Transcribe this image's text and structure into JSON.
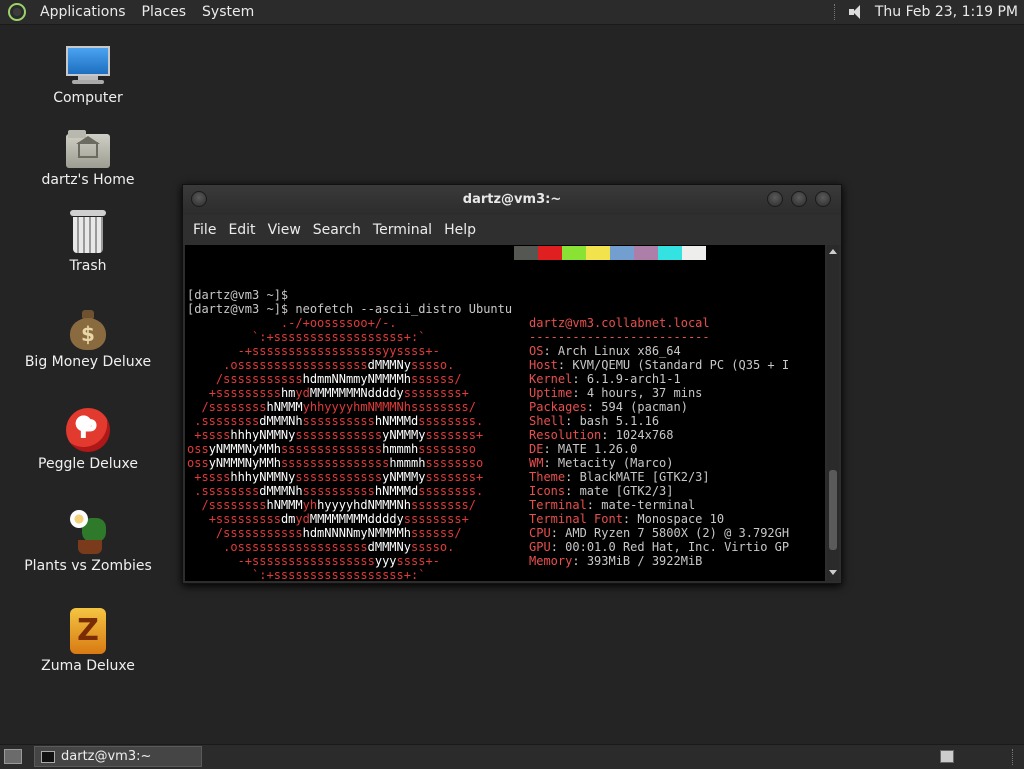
{
  "top_panel": {
    "menus": [
      "Applications",
      "Places",
      "System"
    ],
    "clock": "Thu Feb 23,  1:19 PM",
    "icons": {
      "logo": "mate-logo-icon",
      "volume": "volume-icon"
    }
  },
  "desktop": {
    "icons": [
      {
        "label": "Computer",
        "icon": "computer-icon"
      },
      {
        "label": "dartz's Home",
        "icon": "home-folder-icon"
      },
      {
        "label": "Trash",
        "icon": "trash-icon"
      },
      {
        "label": "Big Money Deluxe",
        "icon": "money-bag-icon"
      },
      {
        "label": "Peggle Deluxe",
        "icon": "peggle-icon"
      },
      {
        "label": "Plants vs Zombies",
        "icon": "plants-vs-zombies-icon"
      },
      {
        "label": "Zuma Deluxe",
        "icon": "zuma-icon"
      }
    ]
  },
  "terminal": {
    "title": "dartz@vm3:~",
    "menu": [
      "File",
      "Edit",
      "View",
      "Search",
      "Terminal",
      "Help"
    ],
    "palette": [
      "#555753",
      "#e02020",
      "#8ae234",
      "#f2e34c",
      "#729fcf",
      "#ad7fa8",
      "#34e2e2",
      "#eeeeec"
    ],
    "prompt_lines": [
      "[dartz@vm3 ~]$",
      "[dartz@vm3 ~]$ neofetch --ascii_distro Ubuntu"
    ],
    "ascii_art": [
      [
        "             ",
        ".-/+oossssoo+/-.",
        ""
      ],
      [
        "         ",
        "`:+ssssssssssssssssss+:`",
        ""
      ],
      [
        "       ",
        "-+ssssssssssssssssssyyssss+-",
        ""
      ],
      [
        "     ",
        ".ossssssssssssssssss",
        "dMMMNy",
        "sssso."
      ],
      [
        "    ",
        "/sssssssssss",
        "hdmmNNmmyNMMMMh",
        "ssssss/"
      ],
      [
        "   ",
        "+sssssssss",
        "hm",
        "yd",
        "MMMMMMMNddddy",
        "ssssssss+"
      ],
      [
        "  ",
        "/ssssssss",
        "hNMMM",
        "yh",
        "hyyyyhmNMMMNh",
        "ssssssss/"
      ],
      [
        " ",
        ".ssssssss",
        "dMMMNh",
        "ssssssssss",
        "hNMMMd",
        "ssssssss."
      ],
      [
        " ",
        "+ssss",
        "hhhyNMMNy",
        "ssssssssssss",
        "yNMMMy",
        "sssssss+"
      ],
      [
        "",
        "oss",
        "yNMMMNyMMh",
        "ssssssssssssss",
        "hmmmh",
        "ssssssso"
      ],
      [
        "",
        "oss",
        "yNMMMNyMMh",
        "sssssssssssssss",
        "hmmmh",
        "ssssssso"
      ],
      [
        " ",
        "+ssss",
        "hhhyNMMNy",
        "ssssssssssss",
        "yNMMMy",
        "sssssss+"
      ],
      [
        " ",
        ".ssssssss",
        "dMMMNh",
        "ssssssssss",
        "hNMMMd",
        "ssssssss."
      ],
      [
        "  ",
        "/ssssssss",
        "hNMMM",
        "yh",
        "hyyyyhdNMMMNh",
        "ssssssss/"
      ],
      [
        "   ",
        "+sssssssss",
        "dm",
        "yd",
        "MMMMMMMMddddy",
        "ssssssss+"
      ],
      [
        "    ",
        "/sssssssssss",
        "hdmNNNNmyNMMMMh",
        "ssssss/"
      ],
      [
        "     ",
        ".ossssssssssssssssss",
        "dMMMNy",
        "sssso."
      ],
      [
        "       ",
        "-+sssssssssssssssss",
        "yyy",
        "ssss+-"
      ],
      [
        "         ",
        "`:+ssssssssssssssssss+:`",
        ""
      ]
    ],
    "info_header": "dartz@vm3.collabnet.local",
    "info_separator": "-------------------------",
    "info": [
      {
        "label": "OS",
        "value": "Arch Linux x86_64"
      },
      {
        "label": "Host",
        "value": "KVM/QEMU (Standard PC (Q35 + I"
      },
      {
        "label": "Kernel",
        "value": "6.1.9-arch1-1"
      },
      {
        "label": "Uptime",
        "value": "4 hours, 37 mins"
      },
      {
        "label": "Packages",
        "value": "594 (pacman)"
      },
      {
        "label": "Shell",
        "value": "bash 5.1.16"
      },
      {
        "label": "Resolution",
        "value": "1024x768"
      },
      {
        "label": "DE",
        "value": "MATE 1.26.0"
      },
      {
        "label": "WM",
        "value": "Metacity (Marco)"
      },
      {
        "label": "Theme",
        "value": "BlackMATE [GTK2/3]"
      },
      {
        "label": "Icons",
        "value": "mate [GTK2/3]"
      },
      {
        "label": "Terminal",
        "value": "mate-terminal"
      },
      {
        "label": "Terminal Font",
        "value": "Monospace 10"
      },
      {
        "label": "CPU",
        "value": "AMD Ryzen 7 5800X (2) @ 3.792GH"
      },
      {
        "label": "GPU",
        "value": "00:01.0 Red Hat, Inc. Virtio GP"
      },
      {
        "label": "Memory",
        "value": "393MiB / 3922MiB"
      }
    ]
  },
  "bottom_panel": {
    "task": "dartz@vm3:~",
    "icons": {
      "show_desktop": "show-desktop-icon",
      "task": "terminal-icon",
      "workspace": "workspace-switcher-icon"
    }
  }
}
